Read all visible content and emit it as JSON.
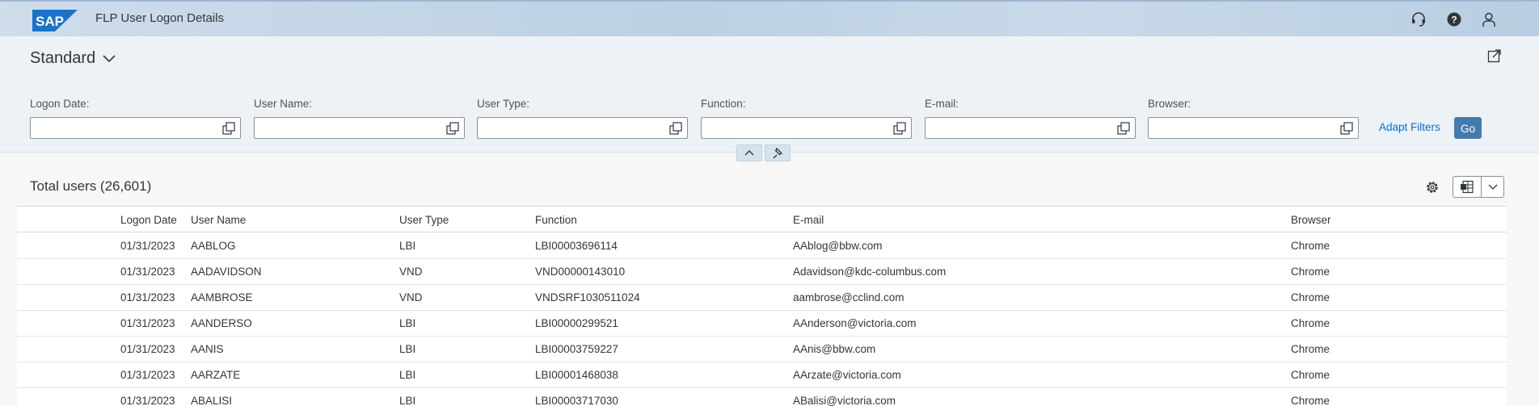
{
  "shell": {
    "logo_text": "SAP",
    "title": "FLP User Logon Details",
    "icons": [
      "headset-icon",
      "help-icon",
      "user-icon"
    ]
  },
  "variant": {
    "name": "Standard"
  },
  "filters": [
    {
      "label": "Logon Date:",
      "value": ""
    },
    {
      "label": "User Name:",
      "value": ""
    },
    {
      "label": "User Type:",
      "value": ""
    },
    {
      "label": "Function:",
      "value": ""
    },
    {
      "label": "E-mail:",
      "value": ""
    },
    {
      "label": "Browser:",
      "value": ""
    }
  ],
  "actions": {
    "adapt_filters": "Adapt Filters",
    "go": "Go"
  },
  "table": {
    "title": "Total users (26,601)",
    "columns": [
      "Logon Date",
      "User Name",
      "User Type",
      "Function",
      "E-mail",
      "Browser"
    ],
    "rows": [
      [
        "01/31/2023",
        "AABLOG",
        "LBI",
        "LBI00003696114",
        "AAblog@bbw.com",
        "Chrome"
      ],
      [
        "01/31/2023",
        "AADAVIDSON",
        "VND",
        "VND00000143010",
        "Adavidson@kdc-columbus.com",
        "Chrome"
      ],
      [
        "01/31/2023",
        "AAMBROSE",
        "VND",
        "VNDSRF1030511024",
        "aambrose@cclind.com",
        "Chrome"
      ],
      [
        "01/31/2023",
        "AANDERSO",
        "LBI",
        "LBI00000299521",
        "AAnderson@victoria.com",
        "Chrome"
      ],
      [
        "01/31/2023",
        "AANIS",
        "LBI",
        "LBI00003759227",
        "AAnis@bbw.com",
        "Chrome"
      ],
      [
        "01/31/2023",
        "AARZATE",
        "LBI",
        "LBI00001468038",
        "AArzate@victoria.com",
        "Chrome"
      ],
      [
        "01/31/2023",
        "ABALISI",
        "LBI",
        "LBI00003717030",
        "ABalisi@victoria.com",
        "Chrome"
      ]
    ]
  },
  "colors": {
    "accent": "#427cac",
    "link": "#0a6ed1",
    "shell": "#c5d6e8",
    "brand": "#1a73c8"
  }
}
